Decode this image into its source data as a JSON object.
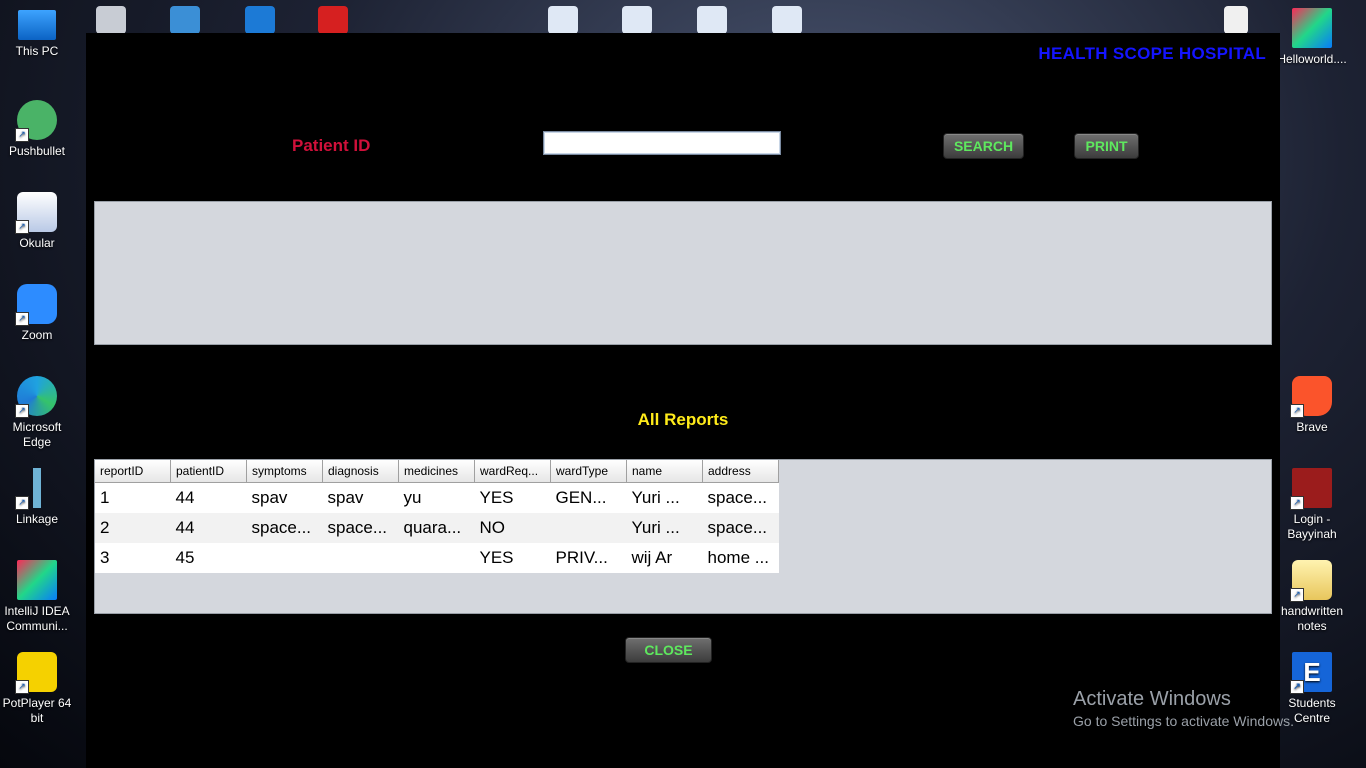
{
  "desktop": {
    "left_icons": [
      {
        "label": "This PC",
        "icon": "computer-icon"
      },
      {
        "label": "Pushbullet",
        "icon": "pushbullet-icon"
      },
      {
        "label": "Okular",
        "icon": "okular-icon"
      },
      {
        "label": "Zoom",
        "icon": "zoom-icon"
      },
      {
        "label": "Microsoft Edge",
        "icon": "edge-icon"
      },
      {
        "label": "Linkage",
        "icon": "linkage-icon"
      },
      {
        "label": "IntelliJ IDEA Communi...",
        "icon": "intellij-icon"
      },
      {
        "label": "PotPlayer 64 bit",
        "icon": "potplayer-icon"
      }
    ],
    "right_icons": [
      {
        "label": "Helloworld....",
        "icon": "intellij-icon"
      },
      {
        "label": "Brave",
        "icon": "brave-icon"
      },
      {
        "label": "Login - Bayyinah",
        "icon": "bayyinah-icon"
      },
      {
        "label": "handwritten notes",
        "icon": "folder-icon"
      },
      {
        "label": "Students Centre",
        "icon": "students-centre-icon"
      }
    ],
    "watermark": {
      "line1": "Activate Windows",
      "line2": "Go to Settings to activate Windows."
    }
  },
  "app": {
    "title": "HEALTH SCOPE HOSPITAL",
    "patient_id_label": "Patient ID",
    "patient_id_value": "",
    "search_label": "SEARCH",
    "print_label": "PRINT",
    "reports_title": "All Reports",
    "close_label": "CLOSE",
    "table": {
      "columns": [
        "reportID",
        "patientID",
        "symptoms",
        "diagnosis",
        "medicines",
        "wardReq...",
        "wardType",
        "name",
        "address"
      ],
      "rows": [
        [
          "1",
          "44",
          "spav",
          "spav",
          "yu",
          "YES",
          "GEN...",
          "Yuri ...",
          "space..."
        ],
        [
          "2",
          "44",
          "space...",
          "space...",
          "quara...",
          "NO",
          "",
          "Yuri ...",
          "space..."
        ],
        [
          "3",
          "45",
          "",
          "",
          "",
          "YES",
          "PRIV...",
          "wij Ar",
          "home ..."
        ]
      ]
    }
  },
  "colors": {
    "title": "#1414ff",
    "patient_label": "#d0103a",
    "reports_title": "#ffeb1a",
    "button_text": "#5ee85e"
  }
}
